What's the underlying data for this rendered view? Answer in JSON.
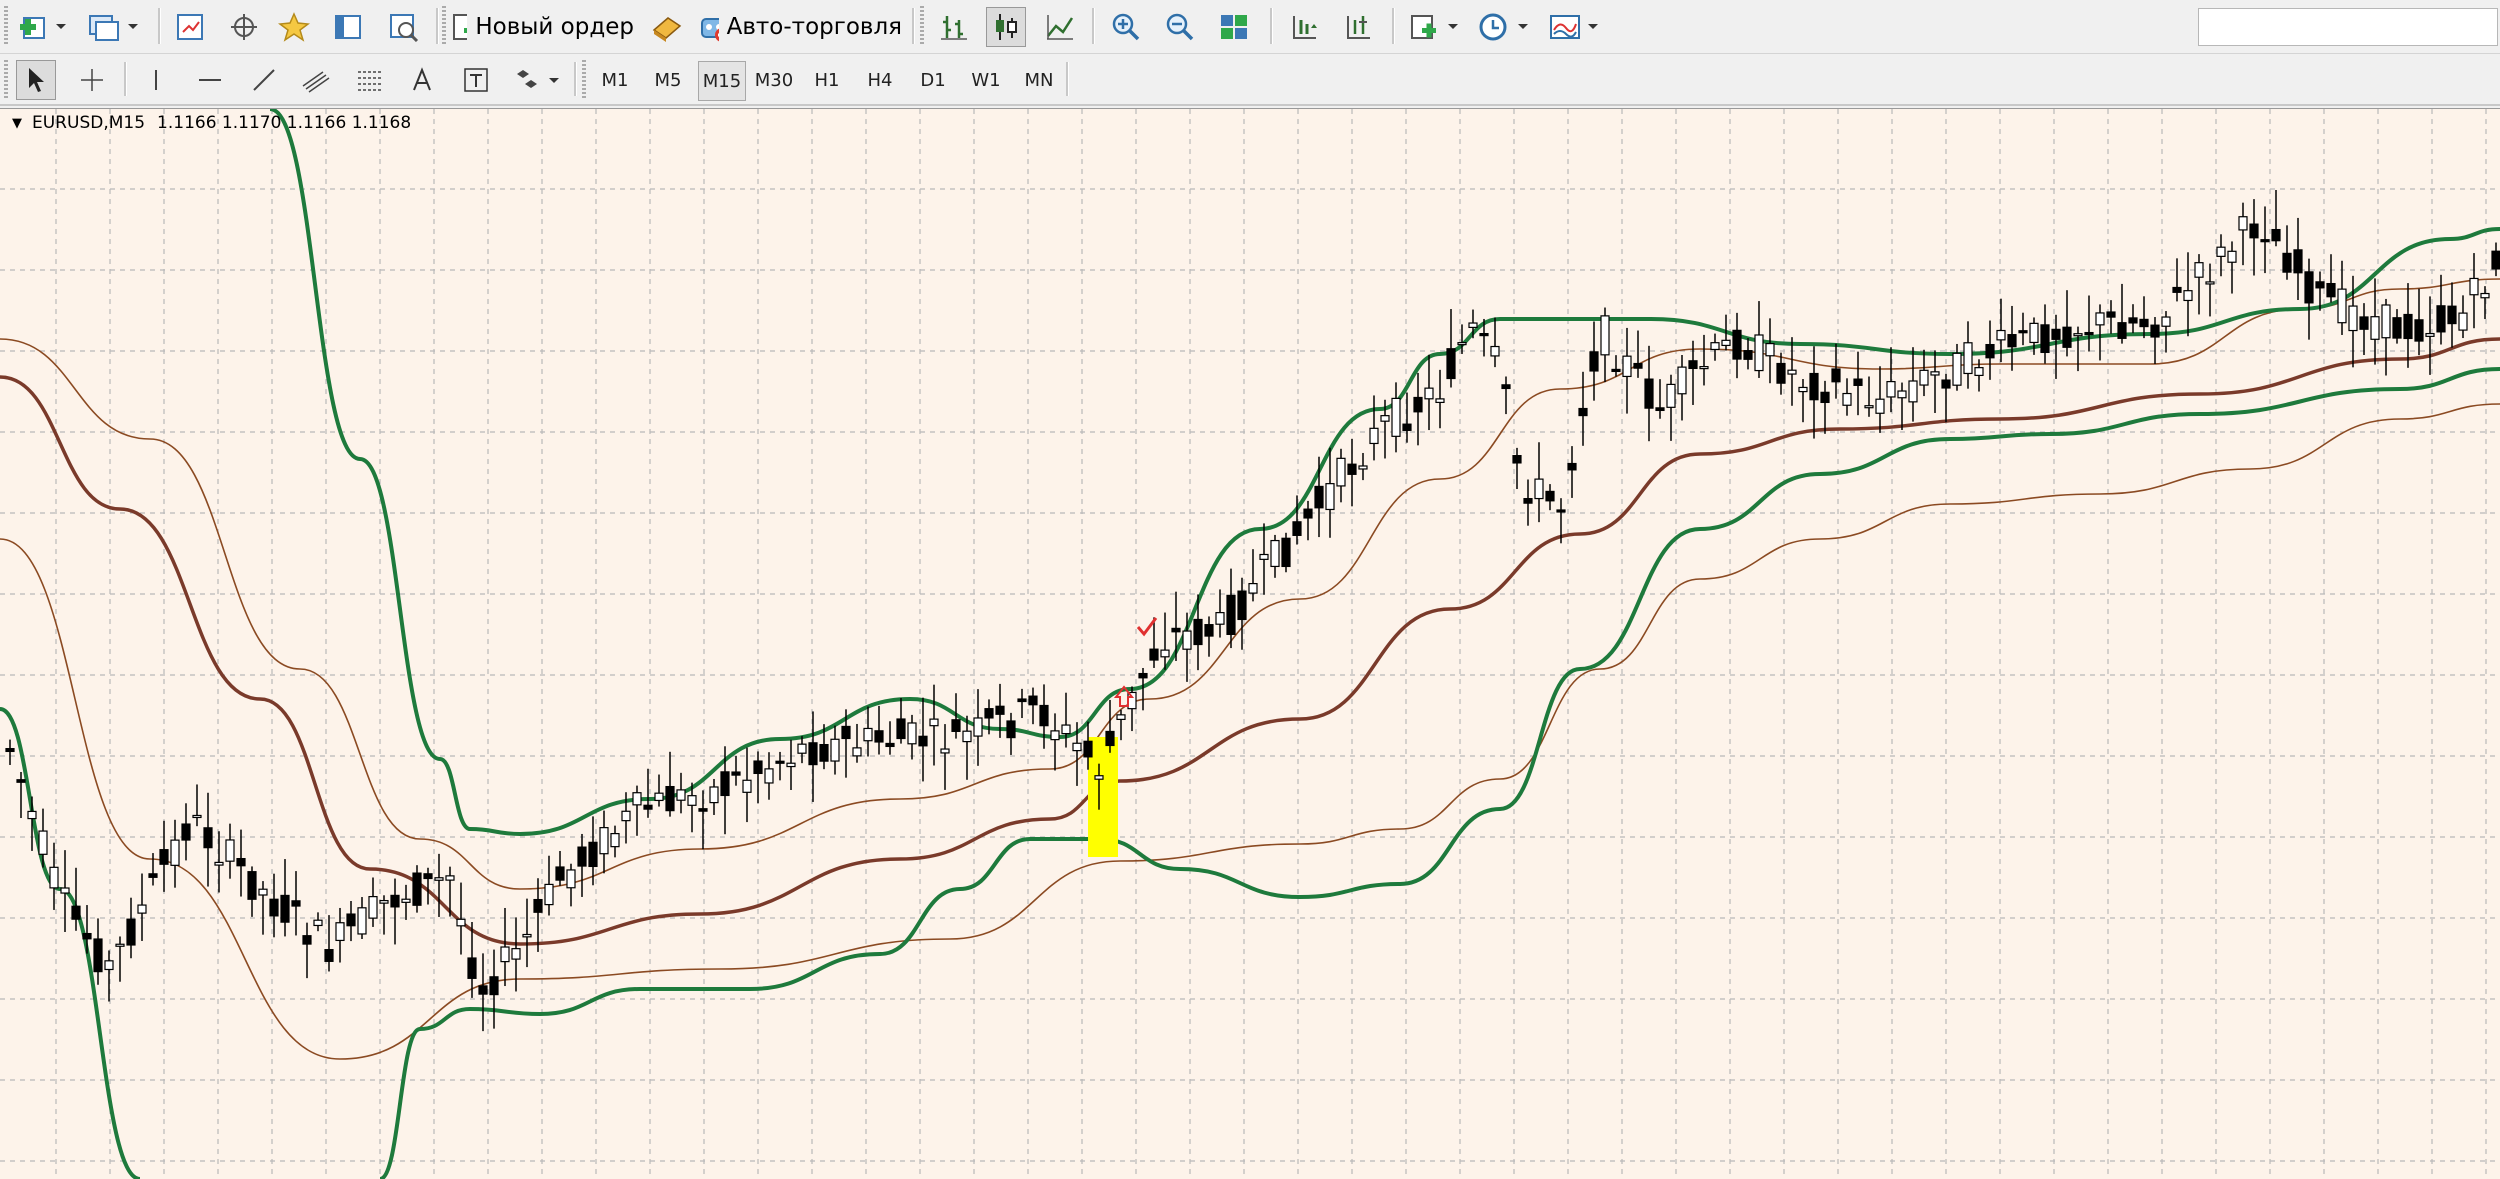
{
  "toolbar": {
    "new_order_label": "Новый ордер",
    "auto_trading_label": "Авто-торговля",
    "search_placeholder": ""
  },
  "timeframes": [
    "M1",
    "M5",
    "M15",
    "M30",
    "H1",
    "H4",
    "D1",
    "W1",
    "MN"
  ],
  "active_timeframe": "M15",
  "chart": {
    "symbol_caption": "EURUSD,M15",
    "prices": "1.1166 1.1170 1.1166 1.1168",
    "background": "#fdf3ea",
    "grid_color": "#b9b9b9",
    "outer_band_color": "#1e7a3c",
    "inner_band_color": "#8b4a22",
    "middle_line_color": "#7a3a2a",
    "highlight_color": "#ffff00",
    "signal_arrow_color": "#e03030",
    "checkmark_color": "#e03030"
  },
  "icons": {
    "new-chart": "plus-chart-icon",
    "profiles": "profiles-icon",
    "market-watch": "market-watch-icon",
    "navigator": "crosshair-icon",
    "favorites": "star-icon",
    "terminal": "terminal-icon",
    "strategy-tester": "tester-icon",
    "auto-trading": "robot-icon",
    "bar-chart": "bar-chart-icon",
    "candles": "candlestick-icon",
    "line-chart": "line-chart-icon",
    "zoom-in": "zoom-in-icon",
    "zoom-out": "zoom-out-icon",
    "tile": "tile-windows-icon",
    "autoscroll": "autoscroll-icon",
    "shift": "chart-shift-icon",
    "indicators": "indicators-icon",
    "periods": "clock-icon",
    "templates": "templates-icon"
  }
}
